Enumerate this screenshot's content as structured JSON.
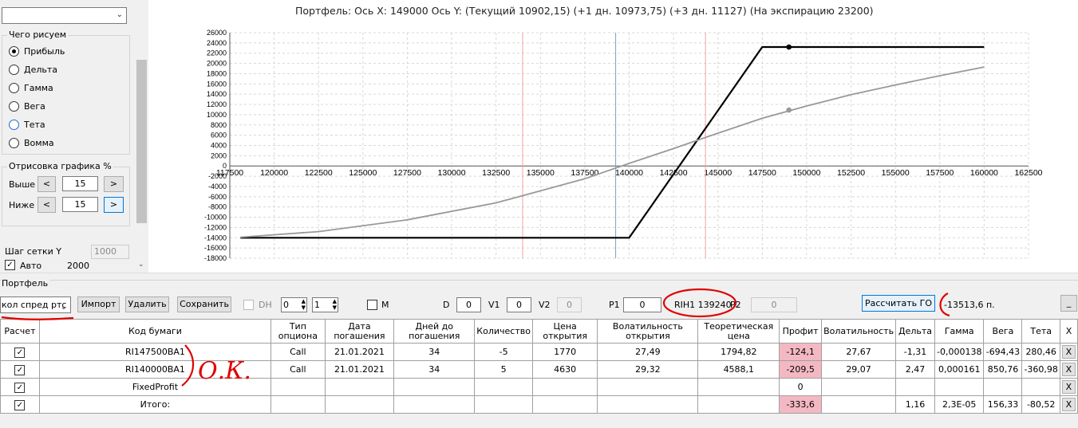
{
  "left_panel": {
    "top_combo_value": "",
    "draw_group": {
      "title": "Чего рисуем",
      "options": [
        {
          "label": "Прибыль",
          "checked": true
        },
        {
          "label": "Дельта",
          "checked": false
        },
        {
          "label": "Гамма",
          "checked": false
        },
        {
          "label": "Вега",
          "checked": false
        },
        {
          "label": "Тета",
          "checked": false
        },
        {
          "label": "Вомма",
          "checked": false
        }
      ]
    },
    "range_group": {
      "title": "Отрисовка графика %",
      "above_label": "Выше",
      "above_value": "15",
      "below_label": "Ниже",
      "below_value": "15",
      "left_btn": "<",
      "right_btn": ">"
    },
    "grid_step_label": "Шаг сетки Y",
    "grid_step_value": "1000",
    "auto_label": "Авто",
    "auto_value": "2000"
  },
  "chart_title": "Портфель: Ось X: 149000 Ось Y:  (Текущий 10902,15)  (+1 дн. 10973,75)  (+3 дн. 11127)  (На экспирацию 23200)",
  "chart_data": {
    "type": "line",
    "title": "Портфель: Ось X: 149000 Ось Y:  (Текущий 10902,15)  (+1 дн. 10973,75)  (+3 дн. 11127)  (На экспирацию 23200)",
    "xlim": [
      117500,
      162500
    ],
    "ylim": [
      -18000,
      26000
    ],
    "x_ticks": [
      117500,
      120000,
      122500,
      125000,
      127500,
      130000,
      132500,
      135000,
      137500,
      140000,
      142500,
      145000,
      147500,
      150000,
      152500,
      155000,
      157500,
      160000,
      162500
    ],
    "y_ticks": [
      26000,
      24000,
      22000,
      20000,
      18000,
      16000,
      14000,
      12000,
      10000,
      8000,
      6000,
      4000,
      2000,
      0,
      -2000,
      -4000,
      -6000,
      -8000,
      -10000,
      -12000,
      -14000,
      -16000,
      -18000
    ],
    "vertical_lines": [
      {
        "x": 134000,
        "color": "#f4a0a8"
      },
      {
        "x": 139240,
        "color": "#8a9cb0"
      },
      {
        "x": 144300,
        "color": "#f4a0a8"
      }
    ],
    "series": [
      {
        "color": "#000000",
        "points": [
          [
            118100,
            -14000
          ],
          [
            140000,
            -14000
          ],
          [
            147500,
            23200
          ],
          [
            160000,
            23200
          ]
        ],
        "marker": [
          149000,
          23200
        ]
      },
      {
        "color": "#999999",
        "points": [
          [
            118100,
            -13900
          ],
          [
            122500,
            -12800
          ],
          [
            127500,
            -10500
          ],
          [
            132500,
            -7200
          ],
          [
            137500,
            -2500
          ],
          [
            140000,
            500
          ],
          [
            142500,
            3400
          ],
          [
            145000,
            6400
          ],
          [
            147500,
            9300
          ],
          [
            150000,
            11700
          ],
          [
            152500,
            13900
          ],
          [
            155000,
            15800
          ],
          [
            157500,
            17600
          ],
          [
            160000,
            19300
          ]
        ],
        "marker": [
          149000,
          10902
        ]
      }
    ]
  },
  "portfolio": {
    "title": "Портфель",
    "strategy_combo": "кол спред ртс",
    "import_btn": "Импорт",
    "delete_btn": "Удалить",
    "save_btn": "Сохранить",
    "dh_label": "DH",
    "spin1_value": "0",
    "spin2_value": "1",
    "m_label": "M",
    "d_label": "D",
    "d_value": "0",
    "v1_label": "V1",
    "v1_value": "0",
    "v2_label": "V2",
    "v2_value": "0",
    "p1_label": "P1",
    "p1_value": "0",
    "instrument_label": "RIH1 139240",
    "p2_label": "P2",
    "p2_value": "0",
    "calc_btn": "Рассчитать ГО",
    "go_value": "-13513,6 п.",
    "minimize_btn": "_"
  },
  "table": {
    "headers": [
      "Расчет",
      "Код бумаги",
      "Тип опциона",
      "Дата погашения",
      "Дней до погашения",
      "Количество",
      "Цена открытия",
      "Волатильность открытия",
      "Теоретическая цена",
      "Профит",
      "Волатильность",
      "Дельта",
      "Гамма",
      "Вега",
      "Тета",
      "X"
    ],
    "rows": [
      {
        "checked": true,
        "code": "RI147500BA1",
        "type": "Call",
        "date": "21.01.2021",
        "days": "34",
        "qty": "-5",
        "open_price": "1770",
        "open_vol": "27,49",
        "theo": "1794,82",
        "profit": "-124,1",
        "vol": "27,67",
        "delta": "-1,31",
        "gamma": "-0,000138",
        "vega": "-694,43",
        "theta": "280,46",
        "x": "X"
      },
      {
        "checked": true,
        "code": "RI140000BA1",
        "type": "Call",
        "date": "21.01.2021",
        "days": "34",
        "qty": "5",
        "open_price": "4630",
        "open_vol": "29,32",
        "theo": "4588,1",
        "profit": "-209,5",
        "vol": "29,07",
        "delta": "2,47",
        "gamma": "0,000161",
        "vega": "850,76",
        "theta": "-360,98",
        "x": "X"
      },
      {
        "checked": true,
        "code": "FixedProfit",
        "type": "",
        "date": "",
        "days": "",
        "qty": "",
        "open_price": "",
        "open_vol": "",
        "theo": "",
        "profit": "0",
        "vol": "",
        "delta": "",
        "gamma": "",
        "vega": "",
        "theta": "",
        "x": "X"
      },
      {
        "checked": true,
        "code": "Итого:",
        "type": "",
        "date": "",
        "days": "",
        "qty": "",
        "open_price": "",
        "open_vol": "",
        "theo": "",
        "profit": "-333,6",
        "vol": "",
        "delta": "1,16",
        "gamma": "2,3E-05",
        "vega": "156,33",
        "theta": "-80,52",
        "x": "X"
      }
    ]
  },
  "annotations": {
    "handwritten": "О.К."
  }
}
